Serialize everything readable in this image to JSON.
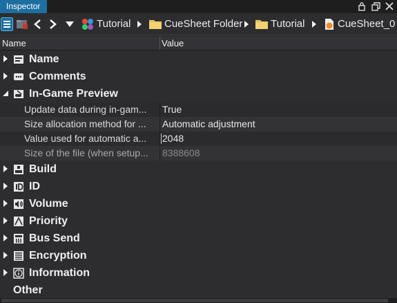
{
  "window": {
    "title": "Inspector"
  },
  "toolbar": {
    "breadcrumbs": [
      {
        "label": "Tutorial",
        "icon": "project-icon"
      },
      {
        "label": "CueSheet Folder",
        "icon": "folder-icon"
      },
      {
        "label": "Tutorial",
        "icon": "folder-icon"
      },
      {
        "label": "CueSheet_0",
        "icon": "cuesheet-icon"
      }
    ]
  },
  "columns": {
    "name": "Name",
    "value": "Value"
  },
  "categories": [
    {
      "label": "Name",
      "icon": "name-icon",
      "expanded": false
    },
    {
      "label": "Comments",
      "icon": "comments-icon",
      "expanded": false
    },
    {
      "label": "In-Game Preview",
      "icon": "ingame-preview-icon",
      "expanded": true,
      "properties": [
        {
          "name": "Update data during in-gam...",
          "value": "True"
        },
        {
          "name": "Size allocation method for ...",
          "value": "Automatic adjustment"
        },
        {
          "name": "Value used for automatic a...",
          "value": "2048"
        },
        {
          "name": "Size of the file (when setup...",
          "value": "8388608"
        }
      ]
    },
    {
      "label": "Build",
      "icon": "build-icon",
      "expanded": false
    },
    {
      "label": "ID",
      "icon": "id-icon",
      "expanded": false
    },
    {
      "label": "Volume",
      "icon": "volume-icon",
      "expanded": false
    },
    {
      "label": "Priority",
      "icon": "priority-icon",
      "expanded": false
    },
    {
      "label": "Bus Send",
      "icon": "bus-send-icon",
      "expanded": false
    },
    {
      "label": "Encryption",
      "icon": "encryption-icon",
      "expanded": false
    },
    {
      "label": "Information",
      "icon": "information-icon",
      "expanded": false
    },
    {
      "label": "Other",
      "icon": "",
      "expanded": false
    }
  ],
  "colors": {
    "accent": "#1c6fa0",
    "background": "#2d2d30",
    "folder": "#e8c25a"
  }
}
